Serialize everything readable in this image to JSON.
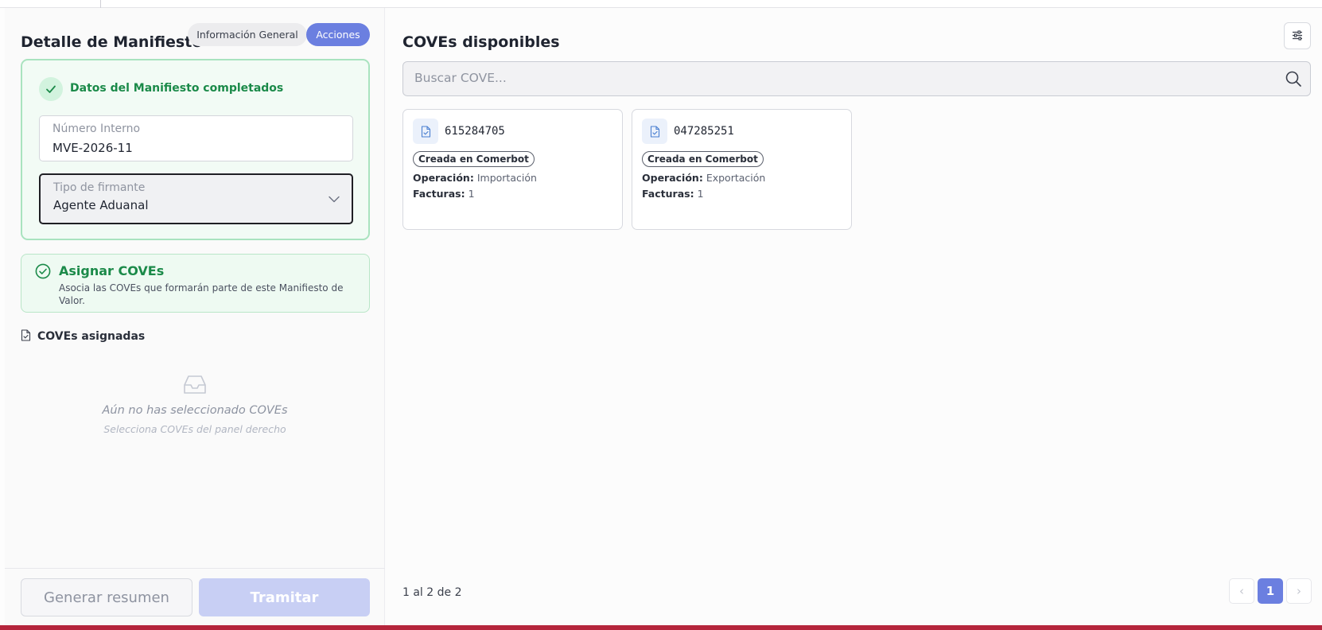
{
  "left": {
    "title": "Detalle de Manifiesto",
    "tabs": [
      {
        "label": "Información General",
        "active": false
      },
      {
        "label": "Acciones",
        "active": true
      }
    ],
    "status": {
      "heading": "Datos del Manifiesto completados"
    },
    "numero_interno": {
      "label": "Número Interno",
      "value": "MVE-2026-11"
    },
    "tipo_firmante": {
      "label": "Tipo de firmante",
      "value": "Agente Aduanal"
    },
    "assign": {
      "title": "Asignar COVEs",
      "description": "Asocia las COVEs que formarán parte de este Manifiesto de Valor."
    },
    "assigned": {
      "label": "COVEs asignadas",
      "empty_title": "Aún no has seleccionado COVEs",
      "empty_subtitle": "Selecciona COVEs del panel derecho"
    },
    "buttons": {
      "resumen": "Generar resumen",
      "tramitar": "Tramitar"
    }
  },
  "right": {
    "title": "COVEs disponibles",
    "search": {
      "placeholder": "Buscar COVE..."
    },
    "coves": [
      {
        "number": "615284705",
        "badge": "Creada en Comerbot",
        "op_label": "Operación:",
        "op_value": "Importación",
        "fac_label": "Facturas:",
        "fac_value": "1"
      },
      {
        "number": "047285251",
        "badge": "Creada en Comerbot",
        "op_label": "Operación:",
        "op_value": "Exportación",
        "fac_label": "Facturas:",
        "fac_value": "1"
      }
    ],
    "pagination": {
      "summary": "1 al 2 de 2",
      "prev": "‹",
      "current": "1",
      "next": "›"
    }
  },
  "colors": {
    "accent": "#6b7fe0",
    "success": "#1b8a49",
    "success_bg": "#f2fbf5",
    "footer_strip": "#b5253c"
  },
  "icons": {
    "status": "check-icon",
    "select": "chevron-down-icon",
    "assign": "check-circle-icon",
    "assigned": "file-check-icon",
    "empty": "inbox-icon",
    "filter": "sliders-icon",
    "search": "search-icon",
    "cove": "file-check-icon"
  }
}
